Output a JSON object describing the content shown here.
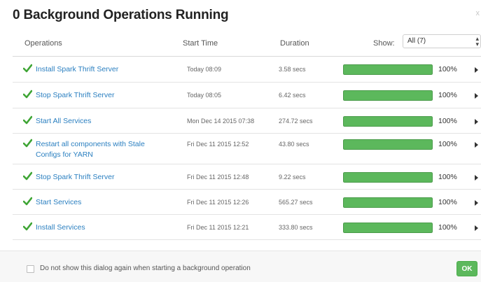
{
  "dialog": {
    "title": "0 Background Operations Running",
    "close_label": "x"
  },
  "table": {
    "headers": {
      "operations": "Operations",
      "start_time": "Start Time",
      "duration": "Duration",
      "show_label": "Show:",
      "show_value": "All (7)"
    },
    "rows": [
      {
        "name": "Install Spark Thrift Server",
        "start": "Today 08:09",
        "duration": "3.58 secs",
        "progress": 100,
        "progress_label": "100%",
        "status": "success"
      },
      {
        "name": "Stop Spark Thrift Server",
        "start": "Today 08:05",
        "duration": "6.42 secs",
        "progress": 100,
        "progress_label": "100%",
        "status": "success"
      },
      {
        "name": "Start All Services",
        "start": "Mon Dec 14 2015 07:38",
        "duration": "274.72 secs",
        "progress": 100,
        "progress_label": "100%",
        "status": "success"
      },
      {
        "name": "Restart all components with Stale Configs for YARN",
        "start": "Fri Dec 11 2015 12:52",
        "duration": "43.80 secs",
        "progress": 100,
        "progress_label": "100%",
        "status": "success"
      },
      {
        "name": "Stop Spark Thrift Server",
        "start": "Fri Dec 11 2015 12:48",
        "duration": "9.22 secs",
        "progress": 100,
        "progress_label": "100%",
        "status": "success"
      },
      {
        "name": "Start Services",
        "start": "Fri Dec 11 2015 12:26",
        "duration": "565.27 secs",
        "progress": 100,
        "progress_label": "100%",
        "status": "success"
      },
      {
        "name": "Install Services",
        "start": "Fri Dec 11 2015 12:21",
        "duration": "333.80 secs",
        "progress": 100,
        "progress_label": "100%",
        "status": "success"
      }
    ]
  },
  "footer": {
    "checkbox_label": "Do not show this dialog again when starting a background operation",
    "ok_label": "OK"
  },
  "colors": {
    "link": "#2a7fc0",
    "success": "#5cb85c",
    "check": "#3fa535"
  }
}
